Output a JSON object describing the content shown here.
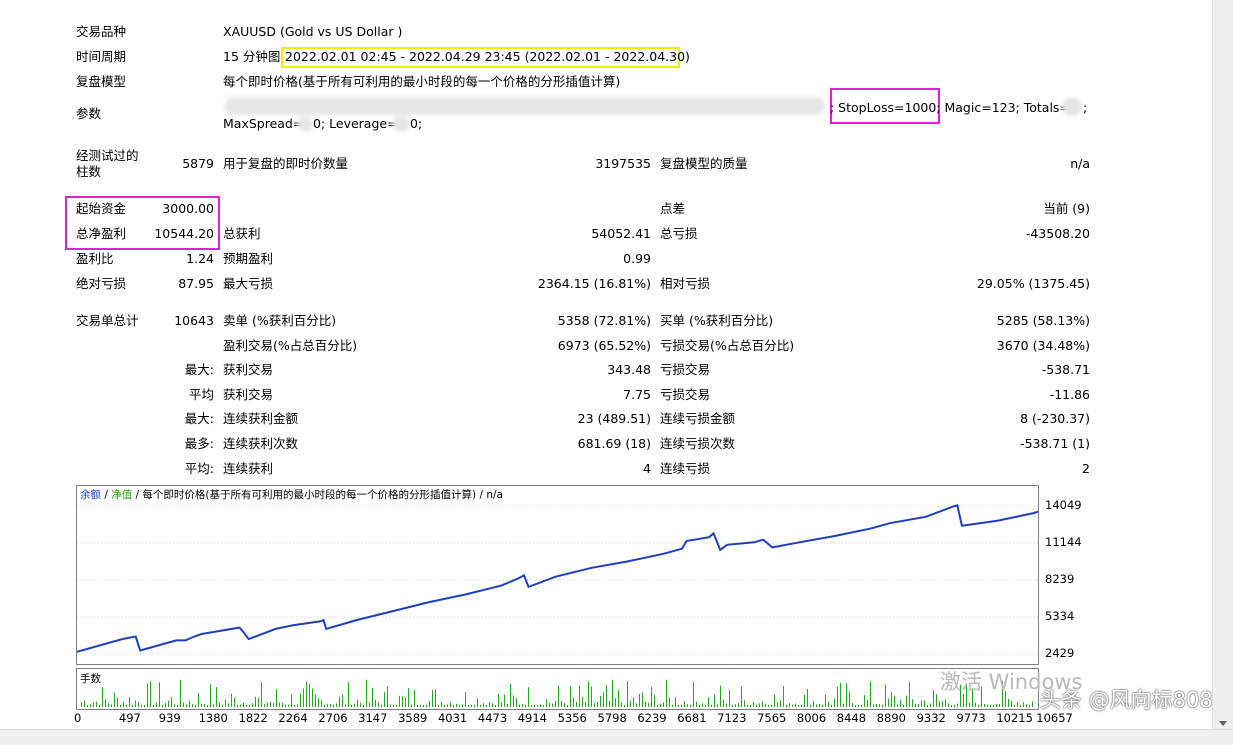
{
  "header": {
    "symbol_label": "交易品种",
    "symbol_value": "XAUUSD (Gold vs US Dollar )",
    "period_label": "时间周期",
    "period_prefix": "15 分钟图",
    "period_range": "2022.02.01 02:45 - 2022.04.29 23:45 (2022.02.01 - 2022.04.30)",
    "model_label": "复盘模型",
    "model_value": "每个即时价格(基于所有可利用的最小时段的每一个价格的分形插值计算)",
    "params_label": "参数",
    "params_line1_suffix": "; StopLoss=1000; Magic=123; Totals=",
    "params_line1_end": ";",
    "params_line2_a": "MaxSpread=",
    "params_line2_b": "0; Leverage=",
    "params_line2_c": "0;"
  },
  "bars": {
    "label": "经测试过的柱数",
    "value": "5879",
    "ticks_label": "用于复盘的即时价数量",
    "ticks_value": "3197535",
    "quality_label": "复盘模型的质量",
    "quality_value": "n/a"
  },
  "stats": {
    "initial_deposit_label": "起始资金",
    "initial_deposit": "3000.00",
    "spread_label": "点差",
    "spread_value": "当前 (9)",
    "net_profit_label": "总净盈利",
    "net_profit": "10544.20",
    "gross_profit_label": "总获利",
    "gross_profit": "54052.41",
    "gross_loss_label": "总亏损",
    "gross_loss": "-43508.20",
    "profit_factor_label": "盈利比",
    "profit_factor": "1.24",
    "expected_payoff_label": "预期盈利",
    "expected_payoff": "0.99",
    "abs_dd_label": "绝对亏损",
    "abs_dd": "87.95",
    "max_dd_label": "最大亏损",
    "max_dd": "2364.15 (16.81%)",
    "rel_dd_label": "相对亏损",
    "rel_dd": "29.05% (1375.45)"
  },
  "trades": {
    "total_label": "交易单总计",
    "total": "10643",
    "short_label": "卖单 (%获利百分比)",
    "short": "5358 (72.81%)",
    "long_label": "买单 (%获利百分比)",
    "long": "5285 (58.13%)",
    "profit_trades_label": "盈利交易(%占总百分比)",
    "profit_trades": "6973 (65.52%)",
    "loss_trades_label": "亏损交易(%占总百分比)",
    "loss_trades": "3670 (34.48%)",
    "largest_label": "最大:",
    "largest_profit_label": "获利交易",
    "largest_profit": "343.48",
    "largest_loss_label": "亏损交易",
    "largest_loss": "-538.71",
    "average_label": "平均",
    "avg_profit_label": "获利交易",
    "avg_profit": "7.75",
    "avg_loss_label": "亏损交易",
    "avg_loss": "-11.86",
    "max_label": "最大:",
    "max_consec_wins_label": "连续获利金额",
    "max_consec_wins": "23 (489.51)",
    "max_consec_losses_label": "连续亏损金额",
    "max_consec_losses": "8 (-230.37)",
    "most_label": "最多:",
    "most_consec_profit_label": "连续获利次数",
    "most_consec_profit": "681.69 (18)",
    "most_consec_loss_label": "连续亏损次数",
    "most_consec_loss": "-538.71 (1)",
    "avg2_label": "平均:",
    "avg_consec_wins_label": "连续获利",
    "avg_consec_wins": "4",
    "avg_consec_losses_label": "连续亏损",
    "avg_consec_losses": "2"
  },
  "chart_legend": {
    "balance": "余额",
    "sep1": " / ",
    "equity": "净值",
    "rest": " / 每个即时价格(基于所有可利用的最小时段的每一个价格的分形插值计算) / n/a",
    "balance_color": "#1f3fbf",
    "equity_color": "#22aa22"
  },
  "volume_label": "手数",
  "watermark": "激活 Windows",
  "watermark2": "头条 @风向标808",
  "chart_data": {
    "type": "line",
    "ylim": [
      2429,
      14049
    ],
    "yticks": [
      "14049",
      "11144",
      "8239",
      "5334",
      "2429"
    ],
    "xticks": [
      "0",
      "497",
      "939",
      "1380",
      "1822",
      "2264",
      "2706",
      "3147",
      "3589",
      "4031",
      "4473",
      "4914",
      "5356",
      "5798",
      "6239",
      "6681",
      "7123",
      "7565",
      "8006",
      "8448",
      "8890",
      "9332",
      "9773",
      "10215",
      "10657"
    ],
    "series": [
      {
        "name": "余额",
        "x": [
          0,
          500,
          650,
          700,
          1000,
          1100,
          1200,
          1300,
          1380,
          1800,
          1850,
          1900,
          2200,
          2400,
          2700,
          2730,
          2760,
          3100,
          3500,
          3900,
          4300,
          4700,
          4900,
          4950,
          5000,
          5300,
          5700,
          6100,
          6500,
          6700,
          6750,
          7000,
          7050,
          7123,
          7200,
          7500,
          7600,
          7700,
          8000,
          8400,
          8800,
          9000,
          9400,
          9700,
          9750,
          9800,
          10200,
          10600,
          10643
        ],
        "y": [
          2600,
          3600,
          3800,
          2700,
          3300,
          3500,
          3500,
          3800,
          4000,
          4500,
          4100,
          3600,
          4400,
          4700,
          5000,
          5100,
          4400,
          5100,
          5800,
          6500,
          7100,
          7800,
          8400,
          8600,
          7700,
          8500,
          9200,
          9700,
          10300,
          10700,
          11300,
          11600,
          11900,
          10600,
          11000,
          11200,
          11400,
          10800,
          11200,
          11700,
          12300,
          12700,
          13200,
          14000,
          14100,
          12500,
          12900,
          13500,
          13600
        ]
      }
    ]
  }
}
